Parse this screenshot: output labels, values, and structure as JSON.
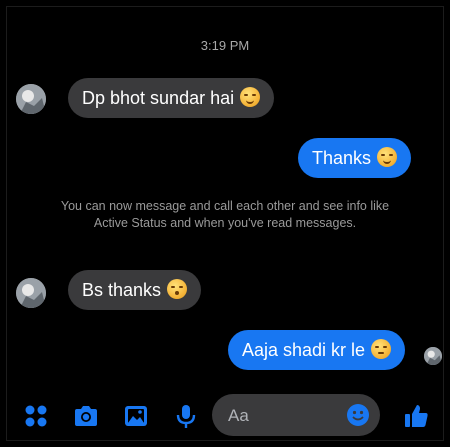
{
  "timestamp": "3:19 PM",
  "messages": [
    {
      "text": "Dp bhot sundar hai",
      "emoji": "smiling-face-icon"
    },
    {
      "text": "Thanks",
      "emoji": "smiling-face-icon"
    },
    {
      "text": "Bs thanks",
      "emoji": "surprised-face-icon"
    },
    {
      "text": "Aaja shadi kr le",
      "emoji": "slightly-frowning-face-icon"
    }
  ],
  "info_text": "You can now message and call each other and see info like Active Status and when you've read messages.",
  "composer": {
    "placeholder": "Aa"
  },
  "colors": {
    "accent": "#1877f2",
    "incoming_bubble": "#3a3a3c",
    "background": "#000000"
  },
  "toolbar_icons": [
    "grid-menu-icon",
    "camera-icon",
    "image-icon",
    "microphone-icon",
    "emoji-icon",
    "thumbs-up-icon"
  ]
}
